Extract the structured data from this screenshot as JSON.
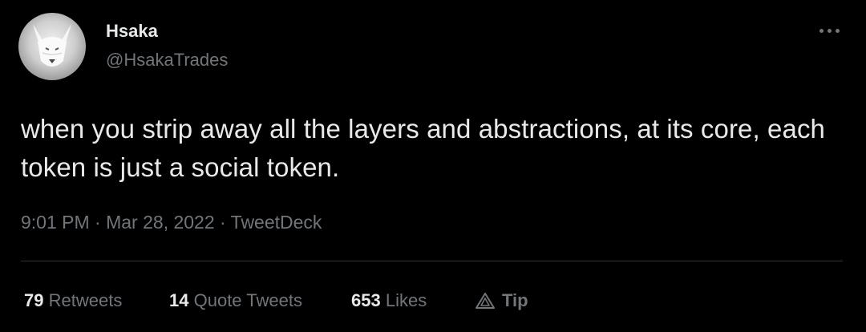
{
  "author": {
    "name": "Hsaka",
    "handle": "@HsakaTrades",
    "avatar_icon": "white-wolf-avatar-icon"
  },
  "more_icon": "more-options-icon",
  "tweet": {
    "text": "when you strip away all the layers and abstractions, at its core, each token is just a social token."
  },
  "meta": {
    "time": "9:01 PM",
    "separator": " · ",
    "date": "Mar 28, 2022",
    "source": "TweetDeck"
  },
  "stats": {
    "retweets_count": "79",
    "retweets_label": "Retweets",
    "quotes_count": "14",
    "quotes_label": "Quote Tweets",
    "likes_count": "653",
    "likes_label": "Likes",
    "tip_label": "Tip",
    "tip_icon": "tip-triangle-icon"
  },
  "colors": {
    "background": "#000000",
    "primary_text": "#e7e9ea",
    "secondary_text": "#71767b",
    "divider": "#2f3336"
  }
}
